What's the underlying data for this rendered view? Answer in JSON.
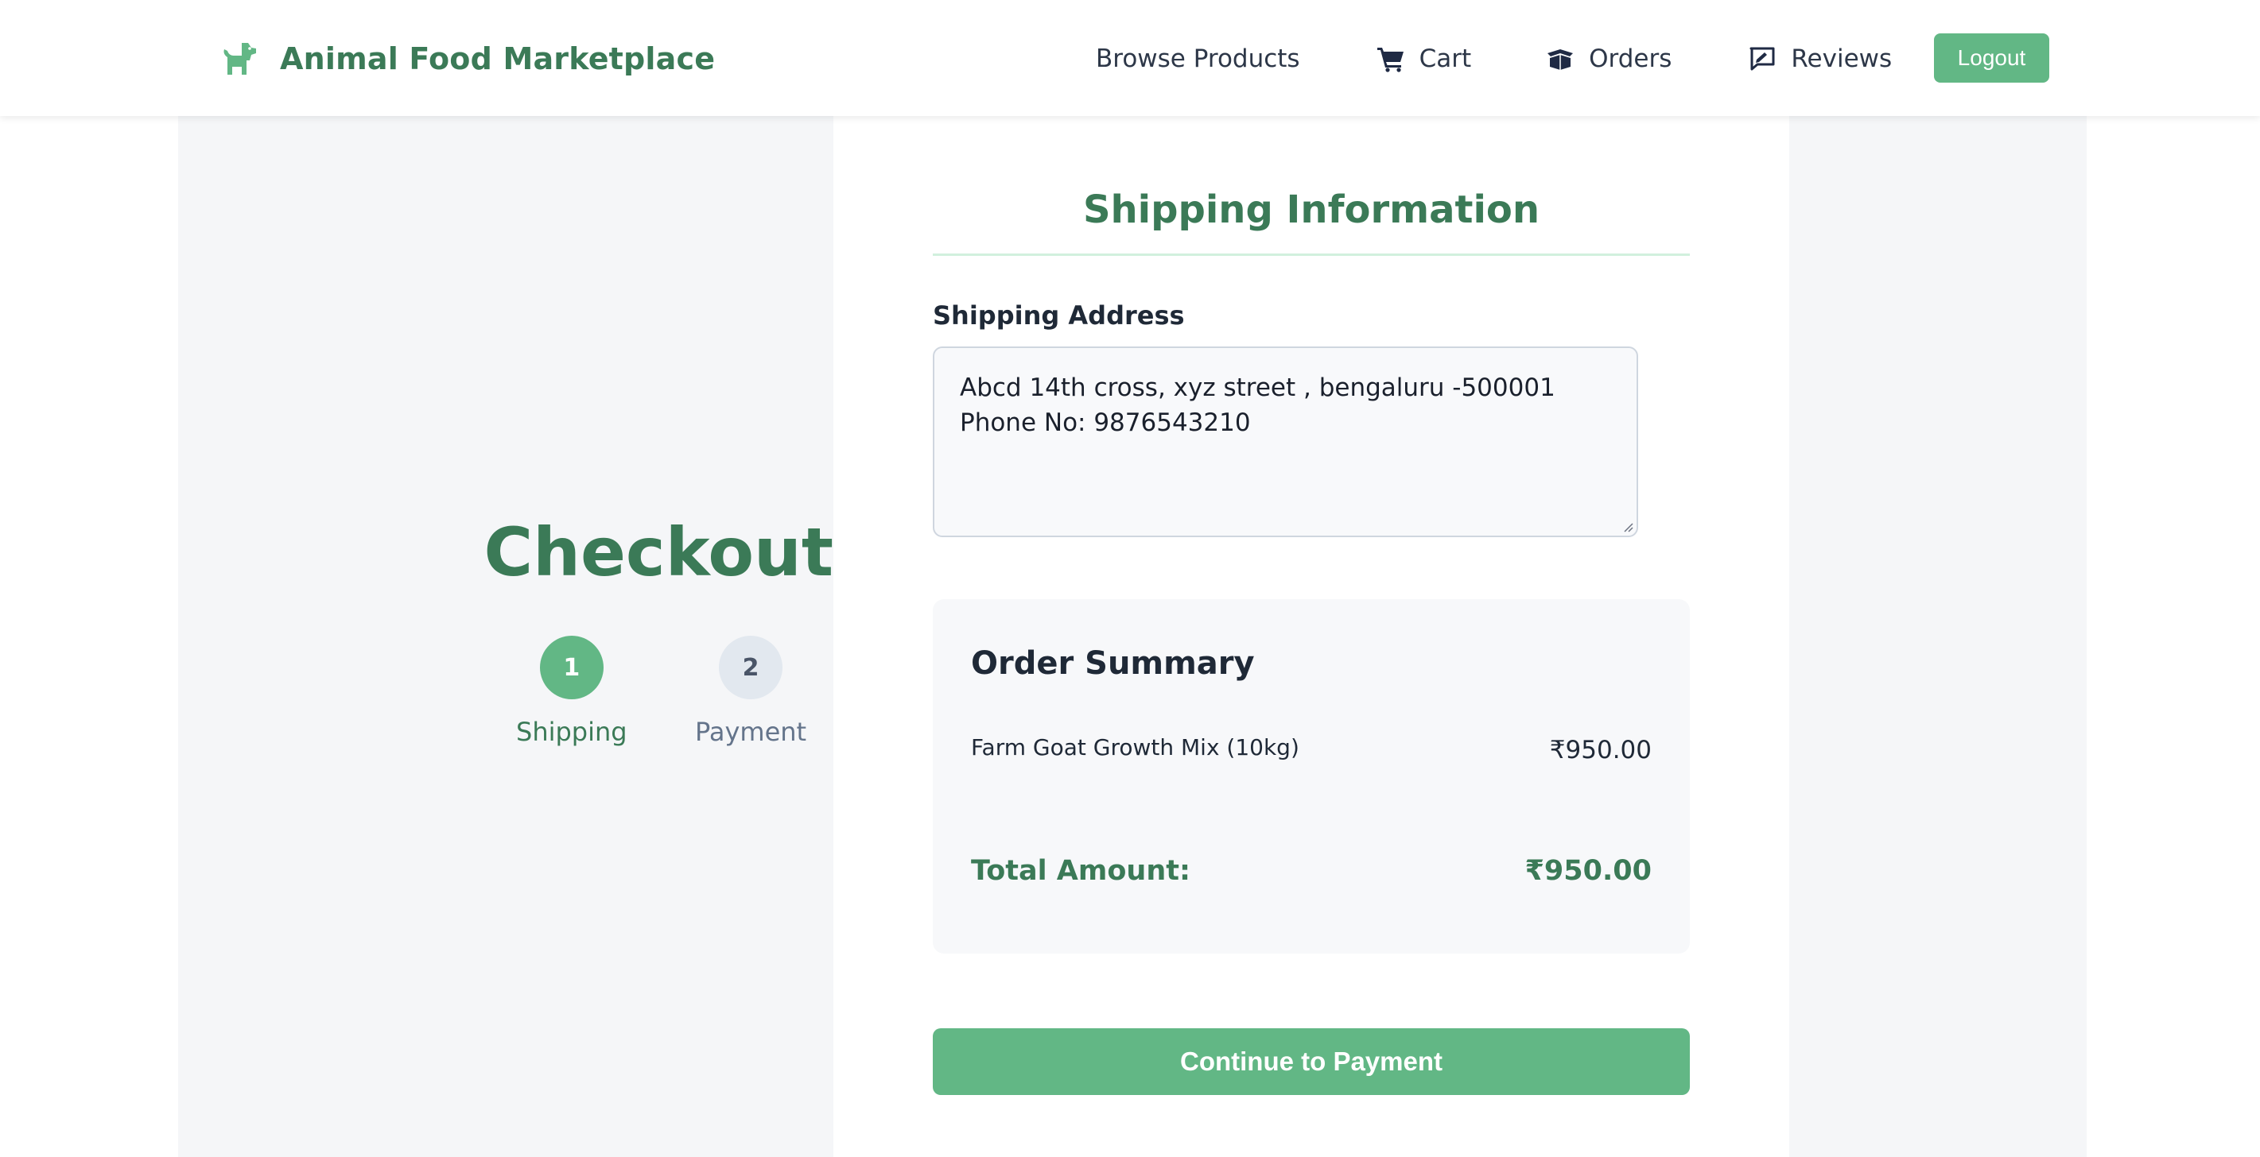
{
  "app": {
    "brand": "Animal Food Marketplace",
    "brand_icon": "dog-icon",
    "accent_color": "#62b785",
    "brand_color": "#3b7a57"
  },
  "nav": {
    "items": [
      {
        "label": "Browse Products",
        "icon": ""
      },
      {
        "label": "Cart",
        "icon": "cart-icon"
      },
      {
        "label": "Orders",
        "icon": "box-open-icon"
      },
      {
        "label": "Reviews",
        "icon": "review-icon"
      }
    ],
    "logout_label": "Logout"
  },
  "checkout": {
    "title": "Checkout",
    "steps": [
      {
        "number": "1",
        "label": "Shipping",
        "active": true
      },
      {
        "number": "2",
        "label": "Payment",
        "active": false
      }
    ]
  },
  "shipping": {
    "section_title": "Shipping Information",
    "address_label": "Shipping Address",
    "address_value": "Abcd 14th cross, xyz street , bengaluru -500001\nPhone No: 9876543210"
  },
  "summary": {
    "title": "Order Summary",
    "items": [
      {
        "name": "Farm Goat Growth Mix (10kg)",
        "price": "₹950.00"
      }
    ],
    "total_label": "Total Amount:",
    "total_value": "₹950.00"
  },
  "actions": {
    "continue_label": "Continue to Payment"
  }
}
